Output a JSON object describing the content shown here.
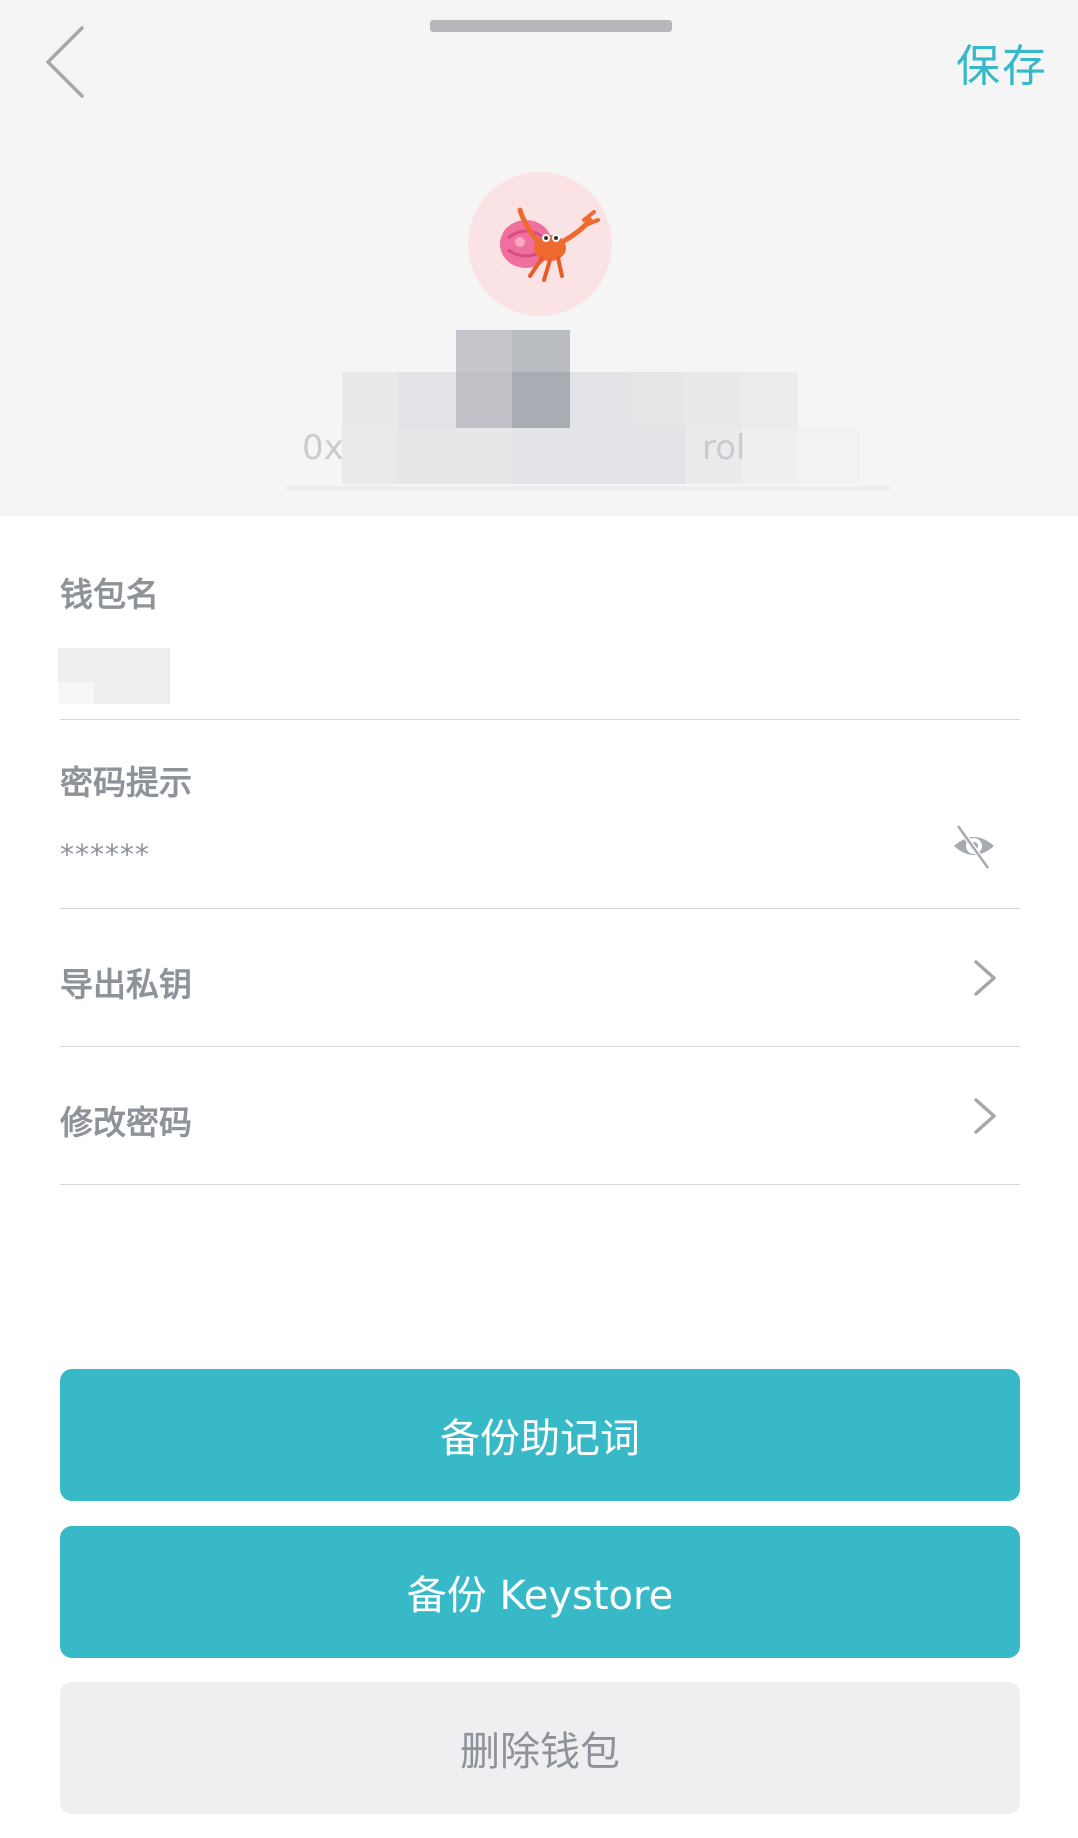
{
  "nav": {
    "save_label": "保存"
  },
  "wallet": {
    "address_prefix_fragment": "0x",
    "address_suffix_fragment": "rol"
  },
  "form": {
    "name_label": "钱包名",
    "hint_label": "密码提示",
    "hint_value": "******"
  },
  "menu": {
    "export_private_key": "导出私钥",
    "change_password": "修改密码"
  },
  "actions": {
    "backup_mnemonic": "备份助记词",
    "backup_keystore": "备份 Keystore",
    "delete_wallet": "删除钱包"
  },
  "icons": {
    "back": "chevron-left-icon",
    "avatar": "hermit-crab-avatar",
    "visibility": "eye-slash-icon",
    "row_arrow": "chevron-right-icon"
  },
  "colors": {
    "accent": "#37b9c8",
    "header_bg": "#f5f5f6",
    "text_muted": "#8e9299",
    "delete_bg": "#efeff1"
  }
}
